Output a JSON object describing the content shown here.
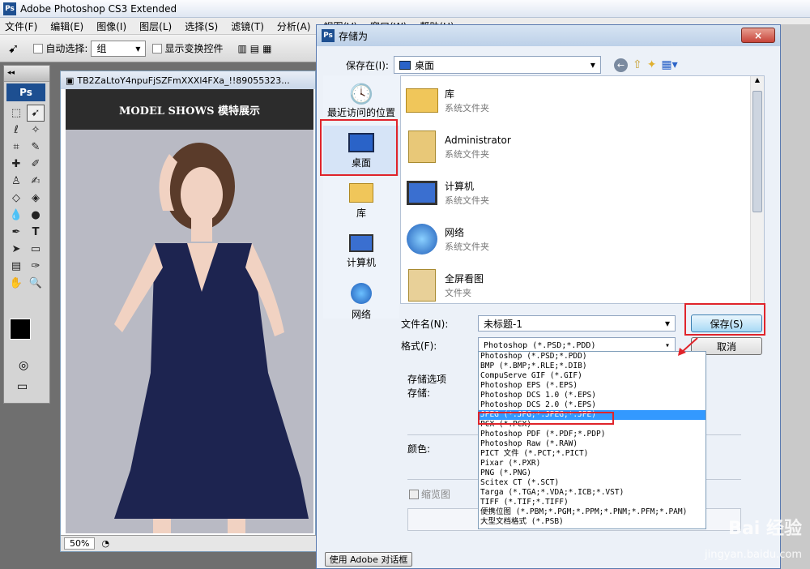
{
  "app": {
    "title": "Adobe Photoshop CS3 Extended",
    "logo": "Ps"
  },
  "menu": [
    "文件(F)",
    "编辑(E)",
    "图像(I)",
    "图层(L)",
    "选择(S)",
    "滤镜(T)",
    "分析(A)",
    "视图(V)",
    "窗口(W)",
    "帮助(H)"
  ],
  "options": {
    "auto_select_label": "自动选择:",
    "auto_select_value": "组",
    "show_transform_label": "显示变换控件"
  },
  "document": {
    "tab_title": "TB2ZaLtoY4npuFjSZFmXXXl4FXa_!!89055323...",
    "banner": "MODEL SHOWS 模特展示",
    "zoom": "50%"
  },
  "dialog": {
    "title": "存储为",
    "close": "×",
    "save_in_label": "保存在(I):",
    "save_in_value": "桌面",
    "places": [
      {
        "label": "最近访问的位置",
        "icon": "recent-icon"
      },
      {
        "label": "桌面",
        "icon": "desktop-icon"
      },
      {
        "label": "库",
        "icon": "library-icon"
      },
      {
        "label": "计算机",
        "icon": "computer-icon"
      },
      {
        "label": "网络",
        "icon": "network-icon"
      }
    ],
    "files": [
      {
        "name": "库",
        "type": "系统文件夹",
        "icon": "library-folder-icon"
      },
      {
        "name": "Administrator",
        "type": "系统文件夹",
        "icon": "user-folder-icon"
      },
      {
        "name": "计算机",
        "type": "系统文件夹",
        "icon": "computer-icon"
      },
      {
        "name": "网络",
        "type": "系统文件夹",
        "icon": "network-globe-icon"
      },
      {
        "name": "全屏看图",
        "type": "文件夹",
        "icon": "folder-icon"
      }
    ],
    "filename_label": "文件名(N):",
    "filename_value": "未标题-1",
    "format_label": "格式(F):",
    "format_value": "Photoshop (*.PSD;*.PDD)",
    "save_button": "保存(S)",
    "cancel_button": "取消",
    "options_label": "存储选项",
    "store_label": "存储:",
    "color_label": "颜色:",
    "thumbnail_label": "缩览图",
    "use_adobe_dialog": "使用 Adobe 对话框",
    "format_options": [
      "Photoshop (*.PSD;*.PDD)",
      "BMP (*.BMP;*.RLE;*.DIB)",
      "CompuServe GIF (*.GIF)",
      "Photoshop EPS (*.EPS)",
      "Photoshop DCS 1.0 (*.EPS)",
      "Photoshop DCS 2.0 (*.EPS)",
      "JPEG (*.JPG;*.JPEG;*.JPE)",
      "PCX (*.PCX)",
      "Photoshop PDF (*.PDF;*.PDP)",
      "Photoshop Raw (*.RAW)",
      "PICT 文件 (*.PCT;*.PICT)",
      "Pixar (*.PXR)",
      "PNG (*.PNG)",
      "Scitex CT (*.SCT)",
      "Targa (*.TGA;*.VDA;*.ICB;*.VST)",
      "TIFF (*.TIF;*.TIFF)",
      "便携位图 (*.PBM;*.PGM;*.PPM;*.PNM;*.PFM;*.PAM)",
      "大型文档格式 (*.PSB)"
    ]
  },
  "watermark": {
    "brand": "Bai 经验",
    "url": "jingyan.baidu.com"
  }
}
